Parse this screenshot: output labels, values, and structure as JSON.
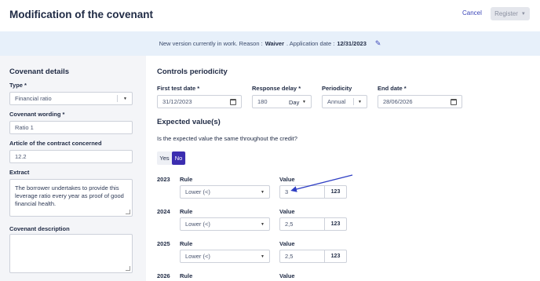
{
  "header": {
    "title": "Modification of the covenant",
    "cancel_label": "Cancel",
    "register_label": "Register"
  },
  "banner": {
    "prefix": "New version currently in work. Reason :",
    "reason": "Waiver",
    "date_prefix": ". Application date :",
    "date": "12/31/2023",
    "edit_icon": "pencil-icon"
  },
  "covenant_details": {
    "title": "Covenant details",
    "type_label": "Type *",
    "type_value": "Financial ratio",
    "wording_label": "Covenant wording *",
    "wording_value": "Ratio 1",
    "article_label": "Article of the contract concerned",
    "article_value": "12.2",
    "extract_label": "Extract",
    "extract_value": "The borrower undertakes to provide this leverage ratio every year as proof of good financial health.",
    "description_label": "Covenant description",
    "description_value": ""
  },
  "controls": {
    "title": "Controls periodicity",
    "first_test_label": "First test date *",
    "first_test_value": "31/12/2023",
    "response_delay_label": "Response delay *",
    "response_delay_value": "180",
    "response_delay_unit": "Day",
    "periodicity_label": "Periodicity",
    "periodicity_value": "Annual",
    "end_date_label": "End date *",
    "end_date_value": "28/06/2026"
  },
  "expected": {
    "title": "Expected value(s)",
    "question": "Is the expected value the same throughout the credit?",
    "yes_label": "Yes",
    "no_label": "No",
    "selected": "No",
    "rule_label": "Rule",
    "value_label": "Value",
    "unit_label": "123",
    "rows": [
      {
        "year": "2023",
        "rule": "Lower (<)",
        "value": "3"
      },
      {
        "year": "2024",
        "rule": "Lower (<)",
        "value": "2,5"
      },
      {
        "year": "2025",
        "rule": "Lower (<)",
        "value": "2,5"
      },
      {
        "year": "2026",
        "rule": "",
        "value": ""
      }
    ]
  },
  "annotation": {
    "arrow_color": "#2f3fc4"
  }
}
